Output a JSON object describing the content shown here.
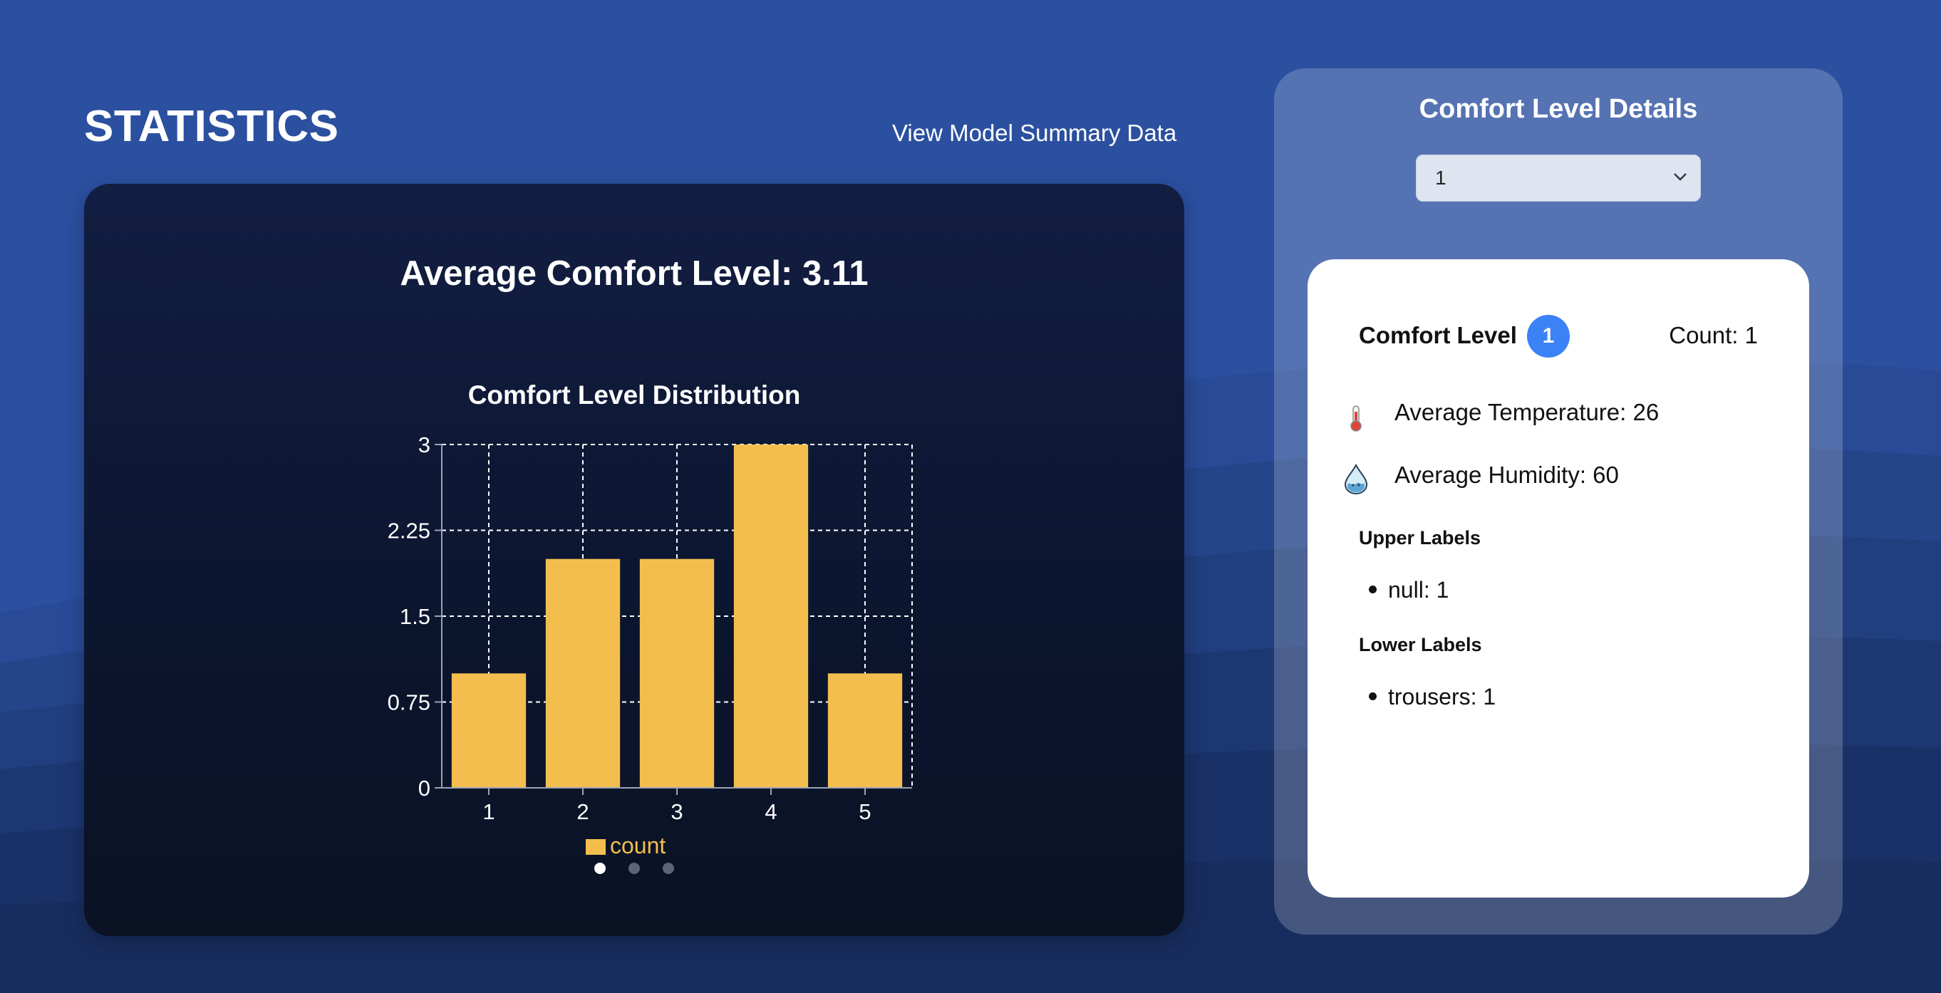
{
  "header": {
    "title": "STATISTICS",
    "summary_link": "View Model Summary Data"
  },
  "stats_card": {
    "average_title": "Average Comfort Level: 3.11",
    "carousel": {
      "dot_count": 3,
      "active_index": 0
    }
  },
  "chart_data": {
    "type": "bar",
    "title": "Comfort Level Distribution",
    "categories": [
      "1",
      "2",
      "3",
      "4",
      "5"
    ],
    "series": [
      {
        "name": "count",
        "values": [
          1,
          2,
          2,
          3,
          1
        ],
        "color": "#f4be4f"
      }
    ],
    "ylim": [
      0,
      3
    ],
    "yticks": [
      0,
      0.75,
      1.5,
      2.25,
      3
    ],
    "ytick_labels": [
      "0",
      "0.75",
      "1.5",
      "2.25",
      "3"
    ],
    "grid": true,
    "legend": "bottom"
  },
  "details": {
    "title": "Comfort Level Details",
    "selected_level": "1",
    "card": {
      "comfort_label": "Comfort Level",
      "comfort_value": "1",
      "count_text": "Count: 1",
      "temperature_icon": "thermometer-icon",
      "temperature_text": "Average Temperature: 26",
      "humidity_icon": "water-drop-icon",
      "humidity_text": "Average Humidity: 60",
      "upper_labels_title": "Upper Labels",
      "upper_labels": [
        "null: 1"
      ],
      "lower_labels_title": "Lower Labels",
      "lower_labels": [
        "trousers: 1"
      ]
    }
  },
  "colors": {
    "background": "#2b50a0",
    "card_dark": "#0f1a38",
    "bar": "#f4be4f",
    "badge": "#3b82f6"
  }
}
